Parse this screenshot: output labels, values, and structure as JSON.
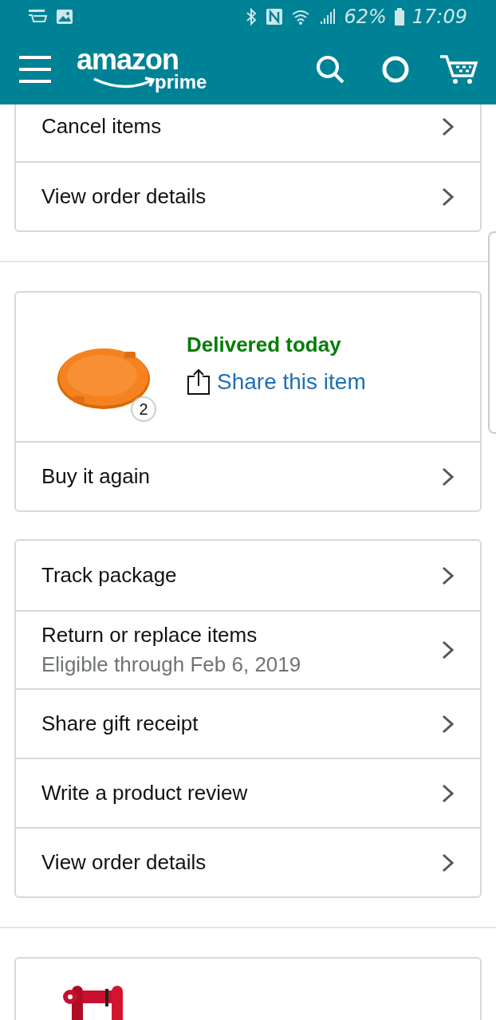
{
  "status_bar": {
    "battery": "62%",
    "time": "17:09"
  },
  "header": {
    "logo_word": "amazon",
    "logo_sub": "prime"
  },
  "groups": [
    {
      "cards": [
        {
          "rows": [
            {
              "label": "Cancel items"
            },
            {
              "label": "View order details"
            }
          ]
        }
      ]
    },
    {
      "cards": [
        {
          "product": {
            "status": "Delivered today",
            "share": "Share this item",
            "quantity": "2",
            "image": {
              "kind": "picture"
            }
          },
          "rows": [
            {
              "label": "Buy it again"
            }
          ]
        },
        {
          "rows": [
            {
              "label": "Track package"
            },
            {
              "label": "Return or replace items",
              "sublabel": "Eligible through Feb 6, 2019"
            },
            {
              "label": "Share gift receipt"
            },
            {
              "label": "Write a product review"
            },
            {
              "label": "View order details"
            }
          ]
        }
      ]
    },
    {
      "cards": [
        {
          "product": {
            "image": {
              "kind": "picture"
            }
          }
        }
      ]
    }
  ]
}
